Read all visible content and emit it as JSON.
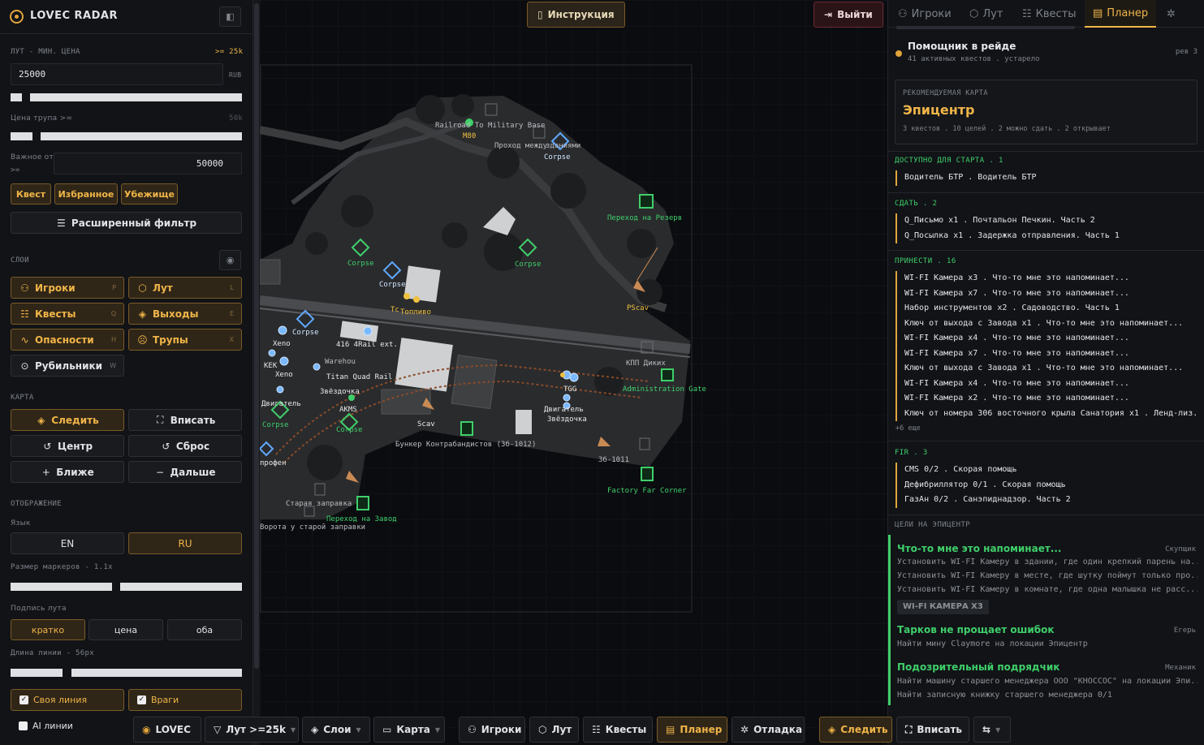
{
  "app": {
    "title": "LOVEC RADAR"
  },
  "sidebar": {
    "loot_label": "ЛУТ - МИН. ЦЕНА",
    "loot_hint": ">= 25k",
    "loot_value": "25000",
    "loot_currency": "RUB",
    "corpse_label": "Цена трупа >=",
    "corpse_hint": "50k",
    "important_label_1": "Важное от",
    "important_label_2": ">=",
    "important_value": "50000",
    "quick_filters": [
      "Квест",
      "Избранное",
      "Убежище"
    ],
    "advanced_filter": "Расширенный фильтр",
    "layers_label": "СЛОИ",
    "layers": [
      {
        "label": "Игроки",
        "key": "P",
        "icon": "users-icon"
      },
      {
        "label": "Лут",
        "key": "L",
        "icon": "box-icon"
      },
      {
        "label": "Квесты",
        "key": "Q",
        "icon": "list-icon"
      },
      {
        "label": "Выходы",
        "key": "E",
        "icon": "exit-icon"
      },
      {
        "label": "Опасности",
        "key": "H",
        "icon": "hazard-icon"
      },
      {
        "label": "Трупы",
        "key": "X",
        "icon": "skull-icon"
      },
      {
        "label": "Рубильники",
        "key": "W",
        "icon": "switch-icon"
      }
    ],
    "map_label": "КАРТА",
    "map_buttons": [
      "Следить",
      "Вписать",
      "Центр",
      "Сброс",
      "Ближе",
      "Дальше"
    ],
    "display_label": "ОТОБРАЖЕНИЕ",
    "lang_label": "Язык",
    "lang_options": [
      "EN",
      "RU"
    ],
    "lang_selected": "RU",
    "marker_label": "Размер маркеров - 1.1x",
    "loot_caption_label": "Подпись лута",
    "loot_caption_options": [
      "кратко",
      "цена",
      "оба"
    ],
    "line_len_label": "Длина линии - 56px",
    "checks": [
      {
        "label": "Своя линия",
        "checked": true
      },
      {
        "label": "Враги",
        "checked": true
      },
      {
        "label": "AI линии",
        "checked": false
      }
    ]
  },
  "map": {
    "instruction_button": "Инструкция",
    "exit_button": "Выйти",
    "labels": {
      "railroad": "Railroad To Military Base",
      "m80": "M80",
      "passage": "Проход между",
      "passage2": "зданиями",
      "corpse": "Corpse",
      "reserve": "Переход на Резерв",
      "toplivo": "Топливо",
      "tc": "Tc",
      "pscav": "PScav",
      "rail416": "416 4Rail ext.",
      "xeno": "Xeno",
      "kek": "KEK",
      "warehouse": "Warehou",
      "titan": "Titan Quad Rail",
      "zvezdochka": "Звёздочка",
      "akms": "AKMS",
      "dvigatel": "Двигатель",
      "kpp": "КПП Диких",
      "admin_gate": "Administration Gate",
      "tgg": "TGG",
      "scav": "Scav",
      "bunker": "Бункер Контрабандистов (3б-1012)",
      "s1011": "3б-1011",
      "factory": "Factory Far Corner",
      "old_gas": "Старая заправка",
      "to_factory": "Переход на Завод",
      "gate_old": "Ворота у старой заправки",
      "profen": "профен"
    }
  },
  "right": {
    "tabs": [
      {
        "label": "Игроки",
        "icon": "users-icon"
      },
      {
        "label": "Лут",
        "icon": "box-icon"
      },
      {
        "label": "Квесты",
        "icon": "list-icon"
      },
      {
        "label": "Планер",
        "icon": "clipboard-icon",
        "active": true
      },
      {
        "label": "",
        "icon": "bug-icon"
      }
    ],
    "assistant_title": "Помощник в рейде",
    "assistant_sub": "41 активных квестов . устарело",
    "assistant_rev": "рев 3",
    "rec_label": "РЕКОМЕНДУЕМАЯ КАРТА",
    "rec_map": "Эпицентр",
    "rec_sub": "3 квестов . 10 целей . 2 можно сдать . 2 открывает",
    "start_label": "ДОСТУПНО ДЛЯ СТАРТА . 1",
    "start_items": [
      "Водитель БТР . Водитель БТР"
    ],
    "turnin_label": "СДАТЬ . 2",
    "turnin_items": [
      "Q_Письмо x1 . Почтальон Печкин. Часть 2",
      "Q_Посылка x1 . Задержка отправления. Часть 1"
    ],
    "bring_label": "ПРИНЕСТИ . 16",
    "bring_items": [
      "WI-FI Камера x3 . Что-то мне это напоминает...",
      "WI-FI Камера x7 . Что-то мне это напоминает...",
      "Набор инструментов x2 . Садоводство. Часть 1",
      "Ключ от выхода с Завода x1 . Что-то мне это напоминает...",
      "WI-FI Камера x4 . Что-то мне это напоминает...",
      "WI-FI Камера x7 . Что-то мне это напоминает...",
      "Ключ от выхода с Завода x1 . Что-то мне это напоминает...",
      "WI-FI Камера x4 . Что-то мне это напоминает...",
      "WI-FI Камера x2 . Что-то мне это напоминает...",
      "Ключ от номера 306 восточного крыла Санатория x1 . Ленд-лиз..."
    ],
    "bring_more": "+6 еще",
    "fir_label": "FIR . 3",
    "fir_items": [
      "CMS 0/2 . Скорая помощь",
      "Дефибриллятор 0/1 . Скорая помощь",
      "ГазАн 0/2 . Санэпиднадзор. Часть 2"
    ],
    "goals_label": "ЦЕЛИ НА ЭПИЦЕНТР",
    "goals": [
      {
        "title": "Что-то мне это напоминает...",
        "trader": "Скупщик",
        "lines": [
          "Установить WI-FI Камеру в здании, где один крепкий парень на...",
          "Установить WI-FI Камеру в месте, где шутку поймут только про...",
          "Установить WI-FI Камеру в комнате, где одна малышка не расс..."
        ],
        "tag": "WI-FI КАМЕРА X3"
      },
      {
        "title": "Тарков не прощает ошибок",
        "trader": "Егерь",
        "lines": [
          "Найти мину Claymore на локации Эпицентр"
        ]
      },
      {
        "title": "Подозрительный подрядчик",
        "trader": "Механик",
        "lines": [
          "Найти машину старшего менеджера ООО \"КНОССОС\" на локации Эпи...",
          "Найти записную книжку старшего менеджера 0/1"
        ]
      }
    ]
  },
  "bottom": {
    "logo": "LOVEC",
    "loot": "Лут >=25k",
    "layers": "Слои",
    "map": "Карта",
    "players": "Игроки",
    "loot2": "Лут",
    "quests": "Квесты",
    "planner": "Планер",
    "debug": "Отладка",
    "follow": "Следить",
    "fit": "Вписать"
  },
  "colors": {
    "accent": "#f0b548",
    "green": "#3fcf6a",
    "bg": "#0c0d11"
  }
}
